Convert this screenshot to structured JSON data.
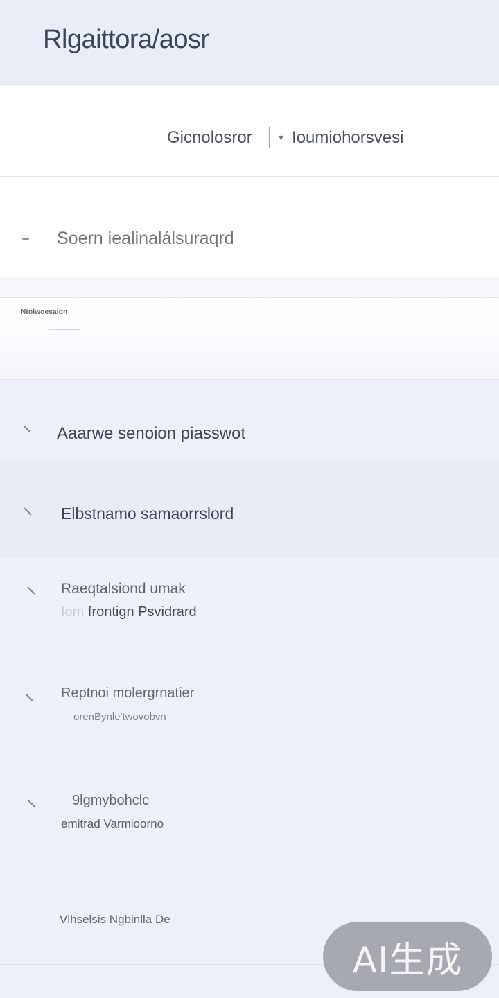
{
  "header": {
    "title": "Rlgaittora/aosr"
  },
  "tabs": {
    "left_label": "Gicnolosror",
    "right_label": "Ioumiohorsvesi",
    "right_icon": "chevron-down-icon"
  },
  "search": {
    "icon": "search-icon",
    "placeholder": "Soern iealinalálsuraqrd",
    "value": ""
  },
  "section": {
    "label": "Ntolwoesaion"
  },
  "list": {
    "items": [
      {
        "title": "Aaarwe senoion piasswot",
        "icon": "chevron-right-icon"
      },
      {
        "title": "Elbstnamo samaorrslord",
        "icon": "chevron-right-icon"
      },
      {
        "title": "Raeqtalsiond umak",
        "sub_faint": "Iom",
        "sub": "frontign Psvidrard",
        "icon": "chevron-right-icon"
      },
      {
        "title": "Reptnoi molergrnatier",
        "sub": "orenBynle'twovobvn",
        "icon": "chevron-right-icon"
      },
      {
        "title": "9lgmybohclc",
        "sub": "emitrad Varmioorno",
        "icon": "chevron-right-icon"
      }
    ]
  },
  "footer": {
    "link_label": "Vlhselsis Ngbinlla De"
  },
  "watermark": {
    "label": "AI生成"
  },
  "colors": {
    "header_bg": "#e8edf8",
    "page_bg": "#eef1f8",
    "text_primary": "#3f4657",
    "badge_bg": "#9699a2"
  }
}
